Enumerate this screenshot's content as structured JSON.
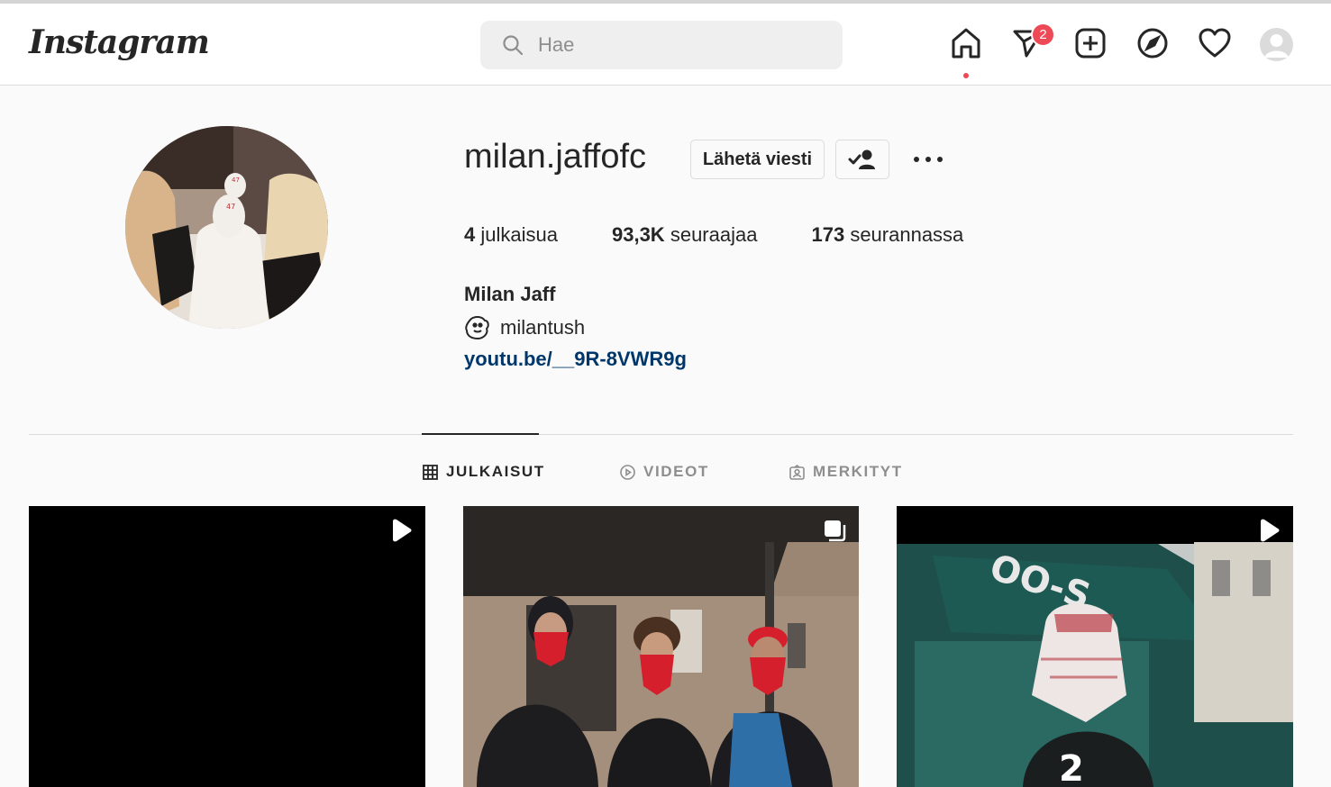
{
  "header": {
    "logo": "Instagram",
    "search_placeholder": "Hae",
    "notification_count": "2"
  },
  "profile": {
    "username": "milan.jaffofc",
    "message_button": "Lähetä viesti",
    "stats": {
      "posts_count": "4",
      "posts_label": "julkaisua",
      "followers_count": "93,3K",
      "followers_label": "seuraajaa",
      "following_count": "173",
      "following_label": "seurannassa"
    },
    "full_name": "Milan Jaff",
    "threads_handle": "milantush",
    "link": "youtu.be/__9R-8VWR9g"
  },
  "tabs": [
    {
      "label": "JULKAISUT",
      "active": true
    },
    {
      "label": "VIDEOT",
      "active": false
    },
    {
      "label": "MERKITYT",
      "active": false
    }
  ],
  "colors": {
    "badge": "#ed4956",
    "link": "#00376b",
    "bandana": "#d61f2c"
  }
}
